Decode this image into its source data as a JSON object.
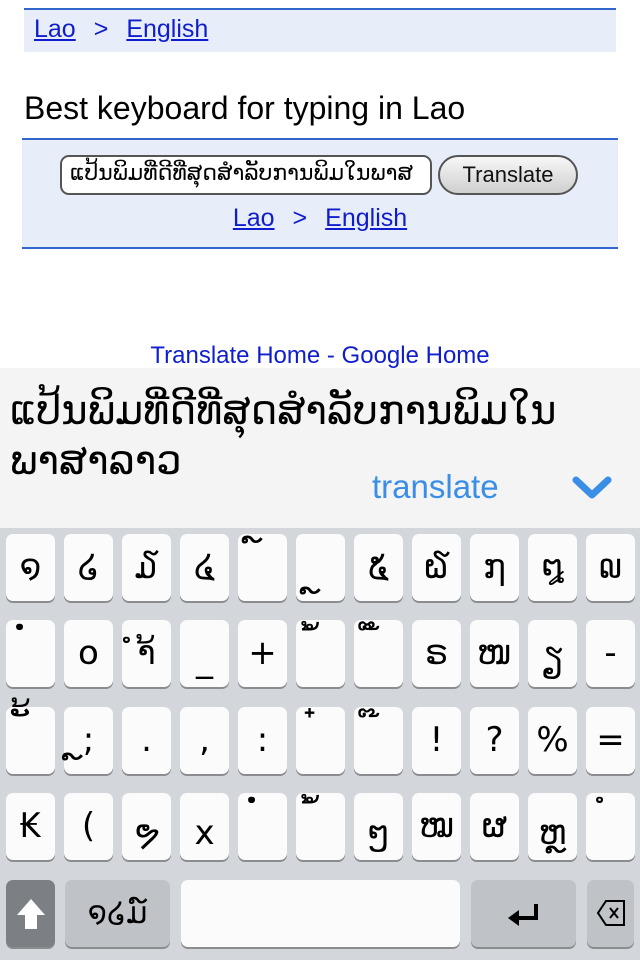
{
  "top_nav": {
    "source_lang": "Lao",
    "separator": ">",
    "target_lang": "English"
  },
  "heading": "Best keyboard for typing in Lao",
  "form": {
    "input_value": "ແປ້ນພິມທີ່ດີທີ່ສຸດສໍາລັບການພິມໃນພາສ",
    "translate_button": "Translate",
    "source_lang": "Lao",
    "separator": ">",
    "target_lang": "English"
  },
  "footer": {
    "translate_home": "Translate Home",
    "dash": " - ",
    "google_home": "Google Home"
  },
  "keyboard_panel": {
    "typed_text": "ແປ້ນພິມທີ່ດີທີ່ສຸດສໍາລັບການພິມໃນພາສາລາວ",
    "translate_label": "translate",
    "collapse_icon": "chevron-down-icon",
    "accent_color": "#3a8ee6"
  },
  "keyboard": {
    "rows": [
      [
        "໑",
        "໒",
        "໓",
        "໔",
        "໌",
        "ຼ",
        "໕",
        "໖",
        "໗",
        "໘",
        "໙"
      ],
      [
        "ໍ່",
        "໐",
        "ຳ້",
        "_",
        "+",
        "ໍ້",
        "ໍ໊",
        "ຣ",
        "ໜ",
        "ຽ",
        "-"
      ],
      [
        "ັ້",
        "ຼ;",
        ".",
        ",",
        ":",
        "໋",
        "໊",
        "!",
        "?",
        "%",
        "="
      ],
      [
        "₭",
        "(",
        "ຯ",
        "x",
        "ໍ່",
        "ໍ້",
        "ໆ",
        "ໝ",
        "ຜ",
        "ຫຼ",
        "ໍ"
      ]
    ],
    "mode_key": "໑໒ມ໌",
    "shift_icon": "shift-arrow-icon",
    "return_icon": "return-icon",
    "delete_icon": "delete-icon"
  }
}
